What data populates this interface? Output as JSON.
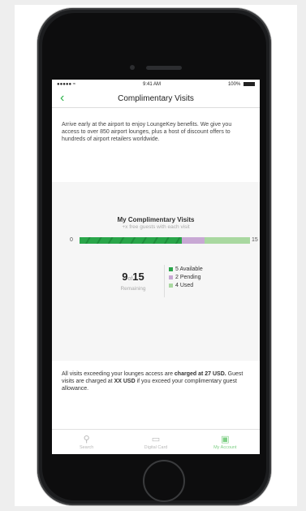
{
  "status_bar": {
    "carrier": "●●●●● ≈",
    "time": "9:41 AM",
    "battery": "100%"
  },
  "nav": {
    "title": "Complimentary Visits"
  },
  "intro": "Arrive early at the airport to enjoy LoungeKey benefits. We give you access to over 850 airport lounges, plus a host of discount offers to hundreds of airport retailers worldwide.",
  "visits": {
    "heading": "My Complimentary Visits",
    "subheading": "+x free guests with each visit",
    "bar_min": "0",
    "bar_max": "15",
    "fill": {
      "available": 9,
      "pending": 2,
      "used": 4,
      "total": 15
    },
    "remaining_count": "9",
    "remaining_of": "of",
    "remaining_total": "15",
    "remaining_label": "Remaining",
    "legend": [
      {
        "label": "5 Available",
        "color": "#2aa64a"
      },
      {
        "label": "2 Pending",
        "color": "#c8a8d4"
      },
      {
        "label": "4 Used",
        "color": "#a9d8a0"
      }
    ]
  },
  "footer": {
    "part1": "All visits exceeding your lounges access are ",
    "bold1": "charged at 27 USD.",
    "part2": " Guest visits are charged at ",
    "bold2": "XX USD",
    "part3": " if you exceed your complimentary guest allowance."
  },
  "tabs": [
    {
      "label": "Search",
      "icon": "search-icon"
    },
    {
      "label": "Digital Card",
      "icon": "card-icon"
    },
    {
      "label": "My Account",
      "icon": "account-icon"
    }
  ],
  "colors": {
    "accent": "#2cb34a"
  }
}
